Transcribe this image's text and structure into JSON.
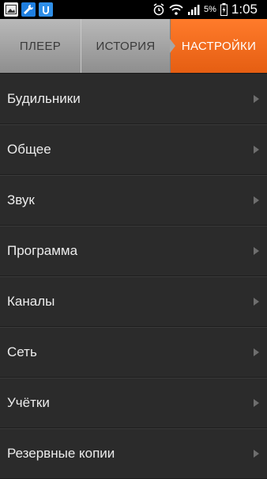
{
  "status_bar": {
    "battery_percent": "5%",
    "time": "1:05",
    "icons": [
      "gallery-icon",
      "wrench-icon",
      "app-icon",
      "alarm-icon",
      "wifi-icon",
      "signal-icon",
      "battery-charging-icon"
    ]
  },
  "tabs": [
    {
      "label": "ПЛЕЕР",
      "active": false
    },
    {
      "label": "ИСТОРИЯ",
      "active": false
    },
    {
      "label": "НАСТРОЙКИ",
      "active": true
    }
  ],
  "accent_color": "#f26a1b",
  "settings": {
    "items": [
      {
        "label": "Будильники"
      },
      {
        "label": "Общее"
      },
      {
        "label": "Звук"
      },
      {
        "label": "Программа"
      },
      {
        "label": "Каналы"
      },
      {
        "label": "Сеть"
      },
      {
        "label": "Учётки"
      },
      {
        "label": "Резервные копии"
      }
    ]
  }
}
